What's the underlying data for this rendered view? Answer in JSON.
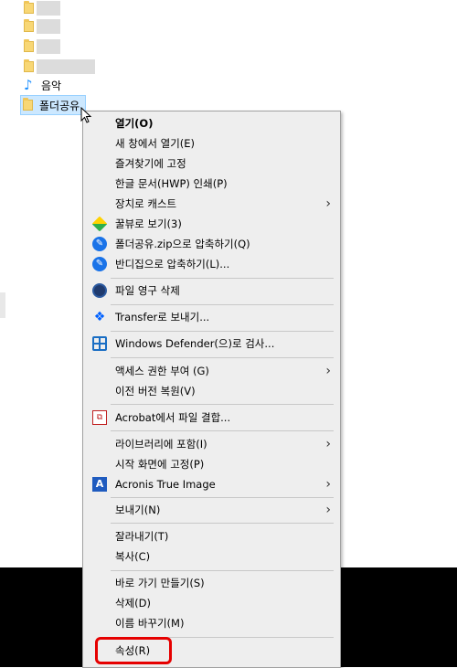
{
  "explorer": {
    "items": [
      {
        "label": "음악",
        "icon": "music-note-icon"
      },
      {
        "label": "폴더공유",
        "icon": "folder-icon"
      }
    ]
  },
  "context_menu": {
    "items": [
      {
        "label": "열기(O)",
        "bold": true
      },
      {
        "label": "새 창에서 열기(E)"
      },
      {
        "label": "즐겨찾기에 고정"
      },
      {
        "label": "한글 문서(HWP) 인쇄(P)"
      },
      {
        "label": "장치로 캐스트",
        "submenu": true
      },
      {
        "label": "꿀뷰로 보기(3)",
        "icon": "honeyview-icon"
      },
      {
        "label": "폴더공유.zip으로 압축하기(Q)",
        "icon": "bandizip-icon"
      },
      {
        "label": "반디집으로 압축하기(L)...",
        "icon": "bandizip-icon"
      },
      {
        "label": "파일 영구 삭제",
        "icon": "ccleaner-icon"
      },
      {
        "label": "Transfer로 보내기...",
        "icon": "dropbox-icon"
      },
      {
        "label": "Windows Defender(으)로 검사...",
        "icon": "windows-defender-icon"
      },
      {
        "label": "액세스 권한 부여 (G)",
        "submenu": true
      },
      {
        "label": "이전 버전 복원(V)"
      },
      {
        "label": "Acrobat에서 파일 결합...",
        "icon": "acrobat-icon"
      },
      {
        "label": "라이브러리에 포함(I)",
        "submenu": true
      },
      {
        "label": "시작 화면에 고정(P)"
      },
      {
        "label": "Acronis True Image",
        "icon": "acronis-icon",
        "submenu": true
      },
      {
        "label": "보내기(N)",
        "submenu": true
      },
      {
        "label": "잘라내기(T)"
      },
      {
        "label": "복사(C)"
      },
      {
        "label": "바로 가기 만들기(S)"
      },
      {
        "label": "삭제(D)"
      },
      {
        "label": "이름 바꾸기(M)"
      },
      {
        "label": "속성(R)",
        "highlighted": true
      }
    ]
  },
  "colors": {
    "menu_bg": "#eeeeee",
    "highlight_border": "#e60000",
    "selection_bg": "#cce8ff"
  }
}
